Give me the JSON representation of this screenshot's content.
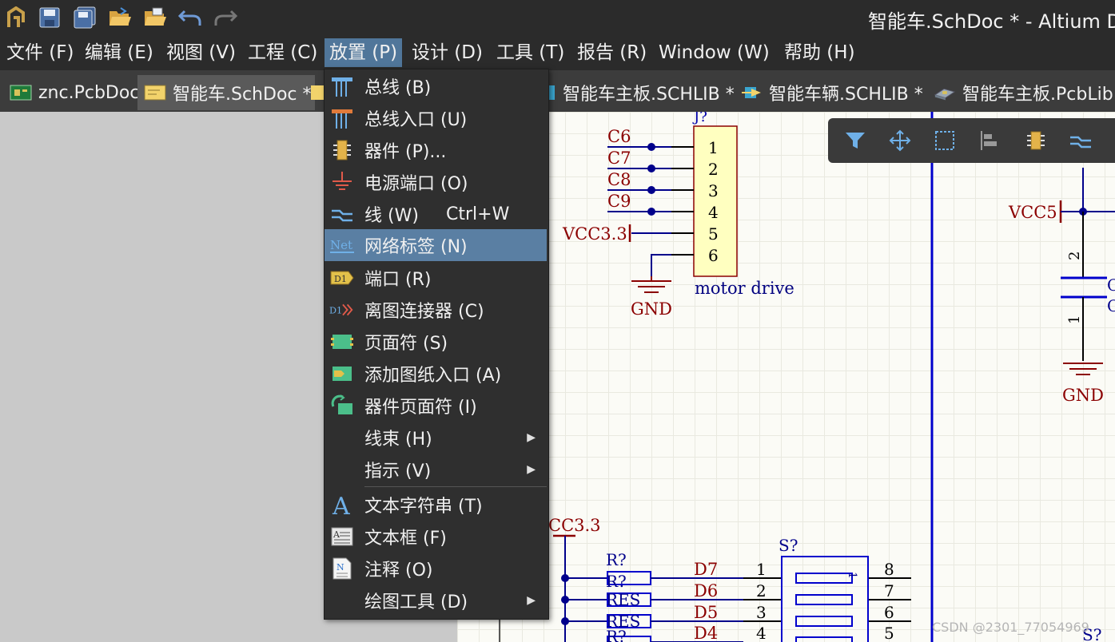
{
  "window": {
    "title": "智能车.SchDoc * - Altium Do"
  },
  "quick_access": [
    {
      "name": "altium-logo-icon"
    },
    {
      "name": "save-icon"
    },
    {
      "name": "save-all-icon"
    },
    {
      "name": "open-icon"
    },
    {
      "name": "open-project-icon"
    },
    {
      "name": "undo-icon"
    },
    {
      "name": "redo-icon"
    }
  ],
  "menubar": {
    "items": [
      "文件 (F)",
      "编辑 (E)",
      "视图 (V)",
      "工程 (C)",
      "放置 (P)",
      "设计 (D)",
      "工具 (T)",
      "报告 (R)",
      "Window (W)",
      "帮助 (H)"
    ],
    "active_index": 4
  },
  "tabs": [
    {
      "label": "znc.PcbDoc",
      "icon": "pcb-doc-icon"
    },
    {
      "label": "智能车.SchDoc *",
      "icon": "sch-doc-icon",
      "active": true
    },
    {
      "label": "智能车主板.SCHLIB *",
      "icon": "schlib-icon"
    },
    {
      "label": "智能车辆.SCHLIB *",
      "icon": "schlib-icon"
    },
    {
      "label": "智能车主板.PcbLib",
      "icon": "pcblib-icon"
    }
  ],
  "place_menu": {
    "items": [
      {
        "label": "总线 (B)",
        "icon": "bus-icon"
      },
      {
        "label": "总线入口 (U)",
        "icon": "bus-entry-icon"
      },
      {
        "label": "器件 (P)...",
        "icon": "part-icon"
      },
      {
        "label": "电源端口 (O)",
        "icon": "power-port-icon"
      },
      {
        "label": "线 (W)",
        "shortcut": "Ctrl+W",
        "icon": "wire-icon"
      },
      {
        "label": "网络标签 (N)",
        "icon": "net-label-icon",
        "highlighted": true
      },
      {
        "label": "端口 (R)",
        "icon": "port-icon"
      },
      {
        "label": "离图连接器 (C)",
        "icon": "off-sheet-connector-icon"
      },
      {
        "label": "页面符 (S)",
        "icon": "sheet-symbol-icon"
      },
      {
        "label": "添加图纸入口 (A)",
        "icon": "sheet-entry-icon"
      },
      {
        "label": "器件页面符 (I)",
        "icon": "device-sheet-symbol-icon"
      },
      {
        "label": "线束 (H)",
        "submenu": true
      },
      {
        "label": "指示 (V)",
        "submenu": true
      },
      {
        "label": "文本字符串 (T)",
        "icon": "text-string-icon"
      },
      {
        "label": "文本框 (F)",
        "icon": "text-frame-icon"
      },
      {
        "label": "注释 (O)",
        "icon": "note-icon"
      },
      {
        "label": "绘图工具 (D)",
        "submenu": true
      }
    ]
  },
  "active_bar": {
    "buttons": [
      "filter-icon",
      "move-icon",
      "select-icon",
      "align-icon",
      "part-icon",
      "wire-icon"
    ]
  },
  "schematic": {
    "j_ref": "J?",
    "j_pins": [
      "1",
      "2",
      "3",
      "4",
      "5",
      "6"
    ],
    "j_nets": [
      "C6",
      "C7",
      "C8",
      "C9"
    ],
    "vcc33": "VCC3.3",
    "gnd": "GND",
    "motor": "motor drive",
    "vcc5": "VCC5",
    "cap_pins": [
      "2",
      "1"
    ],
    "cap_c": "C",
    "cc33": "CC3.3",
    "r_ref": "R?",
    "r_ref2": "R?",
    "res": "RES",
    "res2": "RES",
    "r_partial": "R?",
    "s_ref": "S?",
    "s_ref2": "S?",
    "d_nets": [
      "D7",
      "D6",
      "D5",
      "D4"
    ],
    "s_left": [
      "1",
      "2",
      "3",
      "4"
    ],
    "s_right": [
      "8",
      "7",
      "6",
      "5"
    ],
    "s_one": "1"
  },
  "watermark": "CSDN @2301_77054969",
  "colors": {
    "accent": "#5a7fa3",
    "wire": "#00008b",
    "net": "#8b0000",
    "component_fill": "#ffffc0"
  }
}
